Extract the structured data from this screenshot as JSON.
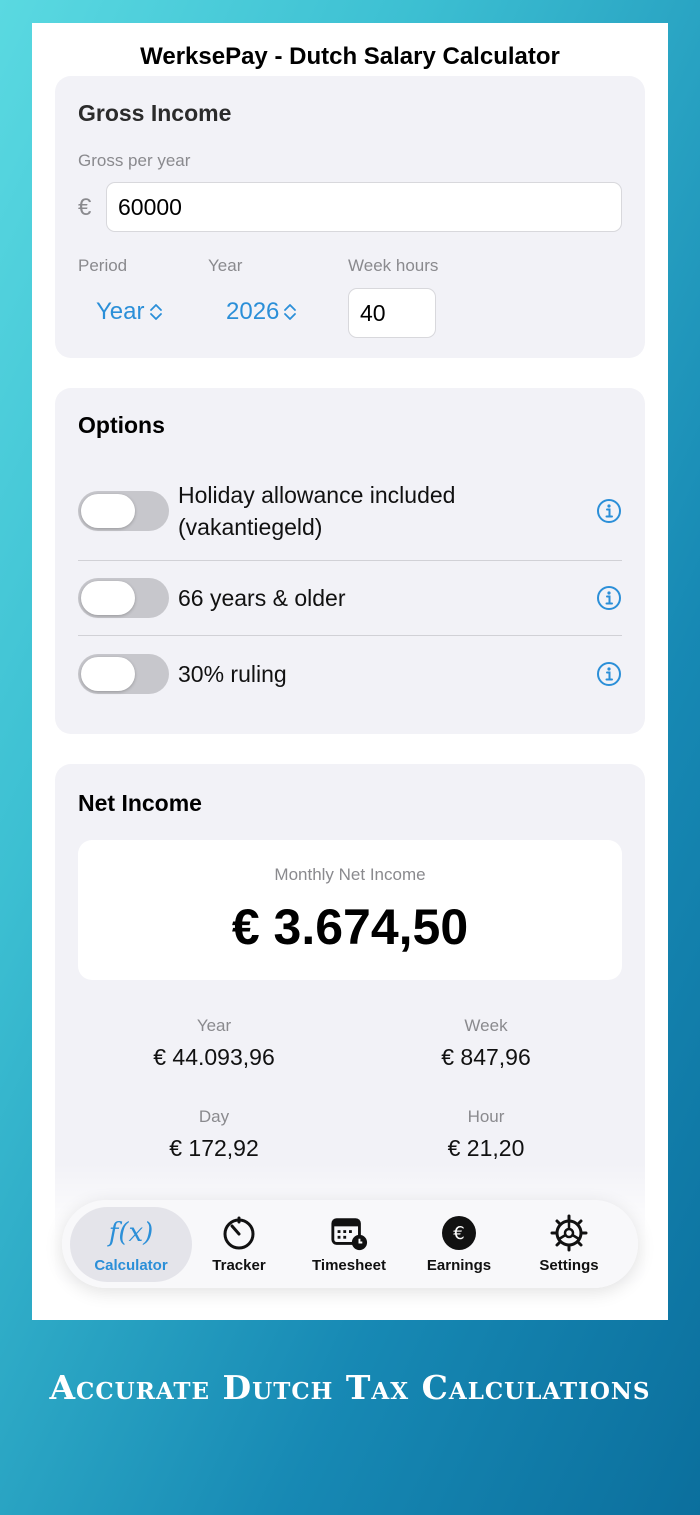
{
  "app": {
    "title": "WerksePay - Dutch Salary Calculator"
  },
  "gross": {
    "title": "Gross Income",
    "per_year_label": "Gross per year",
    "currency_symbol": "€",
    "amount": "60000",
    "period_label": "Period",
    "period_value": "Year",
    "year_label": "Year",
    "year_value": "2026",
    "week_hours_label": "Week hours",
    "week_hours_value": "40"
  },
  "options": {
    "title": "Options",
    "items": [
      {
        "label": "Holiday allowance included (vakantiegeld)",
        "enabled": false,
        "icon": "info-icon"
      },
      {
        "label": "66 years & older",
        "enabled": false,
        "icon": "info-icon"
      },
      {
        "label": "30% ruling",
        "enabled": false,
        "icon": "info-icon"
      }
    ]
  },
  "net": {
    "title": "Net Income",
    "monthly_label": "Monthly Net Income",
    "monthly_value": "€ 3.674,50",
    "stats": [
      {
        "label": "Year",
        "value": "€ 44.093,96"
      },
      {
        "label": "Week",
        "value": "€ 847,96"
      },
      {
        "label": "Day",
        "value": "€ 172,92"
      },
      {
        "label": "Hour",
        "value": "€ 21,20"
      }
    ]
  },
  "tabbar": {
    "active": "Calculator",
    "items": [
      {
        "label": "Calculator",
        "icon": "function-icon"
      },
      {
        "label": "Tracker",
        "icon": "timer-icon"
      },
      {
        "label": "Timesheet",
        "icon": "calendar-clock-icon"
      },
      {
        "label": "Earnings",
        "icon": "euro-circle-icon"
      },
      {
        "label": "Settings",
        "icon": "gear-icon"
      }
    ]
  },
  "colors": {
    "accent": "#2b8fd8",
    "card_bg": "#f2f2f7",
    "toggle_off": "#c7c7cc"
  },
  "tagline": "Accurate Dutch Tax Calculations"
}
